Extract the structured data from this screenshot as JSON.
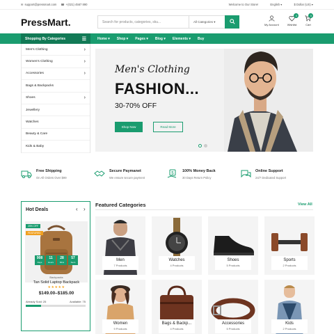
{
  "topbar": {
    "email": "support@pressmart.com",
    "phone": "+(021) 4567 890",
    "welcome": "Welcome to Our Store!",
    "language": "English",
    "currency": "$ Dollar (US)"
  },
  "header": {
    "logo": "PressMart.",
    "search_placeholder": "Search for products, categories, sku...",
    "search_category": "All Categories",
    "account_label": "My Account",
    "wishlist_label": "Wishlist",
    "wishlist_count": "0",
    "cart_label": "Cart",
    "cart_count": "0"
  },
  "nav": {
    "categories_label": "Shopping By Categories",
    "links": [
      "Home",
      "Shop",
      "Pages",
      "Blog",
      "Elements",
      "Buy"
    ]
  },
  "sidebar": {
    "items": [
      {
        "label": "Men's Clothing",
        "arrow": true
      },
      {
        "label": "Women's Clothing",
        "arrow": true
      },
      {
        "label": "Accessories",
        "arrow": true
      },
      {
        "label": "Bags & Backpacks",
        "arrow": false
      },
      {
        "label": "Shoes",
        "arrow": true
      },
      {
        "label": "Jewellery",
        "arrow": false
      },
      {
        "label": "Watches",
        "arrow": false
      },
      {
        "label": "Beauty & Care",
        "arrow": false
      },
      {
        "label": "Kids & Baby",
        "arrow": false
      }
    ]
  },
  "hero": {
    "subtitle": "Men's Clothing",
    "title": "FASHION...",
    "discount": "30-70% OFF",
    "shop_now": "Shop Now",
    "read_more": "Read More",
    "slides": 2,
    "active_slide": 1
  },
  "features": [
    {
      "icon": "truck-icon",
      "title": "Free Shipping",
      "sub": "On All Orders Over $99"
    },
    {
      "icon": "handshake-icon",
      "title": "Secure Paymanet",
      "sub": "We ensure secure payment"
    },
    {
      "icon": "money-back-icon",
      "title": "100% Money Back",
      "sub": "30 Days Return Policy"
    },
    {
      "icon": "chat-icon",
      "title": "Online Support",
      "sub": "24/7 Dedicated Support"
    }
  ],
  "hot_deals": {
    "title": "Hot Deals",
    "tag_off": "25% OFF",
    "tag_featured": "FEATURED",
    "countdown": [
      {
        "value": "908",
        "unit": "Days"
      },
      {
        "value": "11",
        "unit": "Hours"
      },
      {
        "value": "28",
        "unit": "Mins"
      },
      {
        "value": "57",
        "unit": "Secs"
      }
    ],
    "category": "Backpacks",
    "name": "Tan Solid Laptop Backpack",
    "rating": 5,
    "price": "$149.00–$185.00",
    "sold": "Already Sold: 25",
    "available": "Available: 75",
    "sold_fraction": 0.25
  },
  "featured": {
    "title": "Featured Categories",
    "view_all": "View All",
    "categories": [
      {
        "name": "Men",
        "count": "7 Products",
        "icon": "men-image"
      },
      {
        "name": "Watches",
        "count": "4 Products",
        "icon": "watch-image"
      },
      {
        "name": "Shoes",
        "count": "5 Products",
        "icon": "shoe-image"
      },
      {
        "name": "Sports",
        "count": "2 Products",
        "icon": "dumbbell-image"
      },
      {
        "name": "Women",
        "count": "9 Products",
        "icon": "women-image"
      },
      {
        "name": "Bags & Backp...",
        "count": "4 Products",
        "icon": "bag-image"
      },
      {
        "name": "Accessories",
        "count": "5 Products",
        "icon": "belt-image"
      },
      {
        "name": "Kids",
        "count": "2 Products",
        "icon": "kid-image"
      }
    ]
  },
  "colors": {
    "accent": "#1a9c6f",
    "accent_dark": "#127a56",
    "tag_off": "#1a9c6f",
    "tag_featured": "#f0a020"
  }
}
